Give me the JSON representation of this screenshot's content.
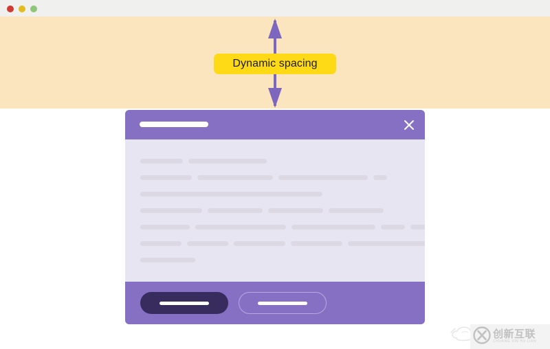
{
  "window": {
    "chrome": {
      "controls": [
        {
          "name": "close",
          "color": "#cf3b33"
        },
        {
          "name": "minimize",
          "color": "#e2bb1e"
        },
        {
          "name": "maximize",
          "color": "#8fc679"
        }
      ]
    },
    "background": "#ffffff"
  },
  "annotation": {
    "band_color": "#fbe5be",
    "arrow_color": "#7d66bd",
    "label": "Dynamic spacing",
    "label_background": "#fdd916",
    "label_text_color": "#1b1b1b",
    "arrow_icon": "double-headed-vertical-arrow-icon"
  },
  "dialog": {
    "header": {
      "background": "#8670c4",
      "title_placeholder": "",
      "close_icon": "close-icon"
    },
    "body": {
      "background": "#e8e5f2",
      "skeleton_color": "#dcd9e4",
      "rows": [
        [
          62,
          114
        ],
        [
          75,
          110,
          130,
          20
        ],
        [
          265
        ],
        [
          90,
          80,
          80,
          80
        ],
        [
          72,
          132,
          122,
          35,
          110
        ],
        [
          60,
          60,
          75,
          75,
          185,
          14
        ],
        [
          80
        ]
      ]
    },
    "footer": {
      "background": "#8670c4",
      "primary_button": {
        "label": "",
        "fill": "#382b5e",
        "label_placeholder_color": "#ffffff"
      },
      "secondary_button": {
        "label": "",
        "border": "#b9a9df",
        "label_placeholder_color": "#ffffff"
      }
    }
  },
  "watermark": {
    "cn_text": "创新互联",
    "pinyin_text": "CHUANG XIN HU LIAN",
    "mark_letter": "X",
    "cloud_icon": "cloud-outline-icon",
    "background": "#f2f2f2",
    "text_color": "#b7b7b7"
  }
}
